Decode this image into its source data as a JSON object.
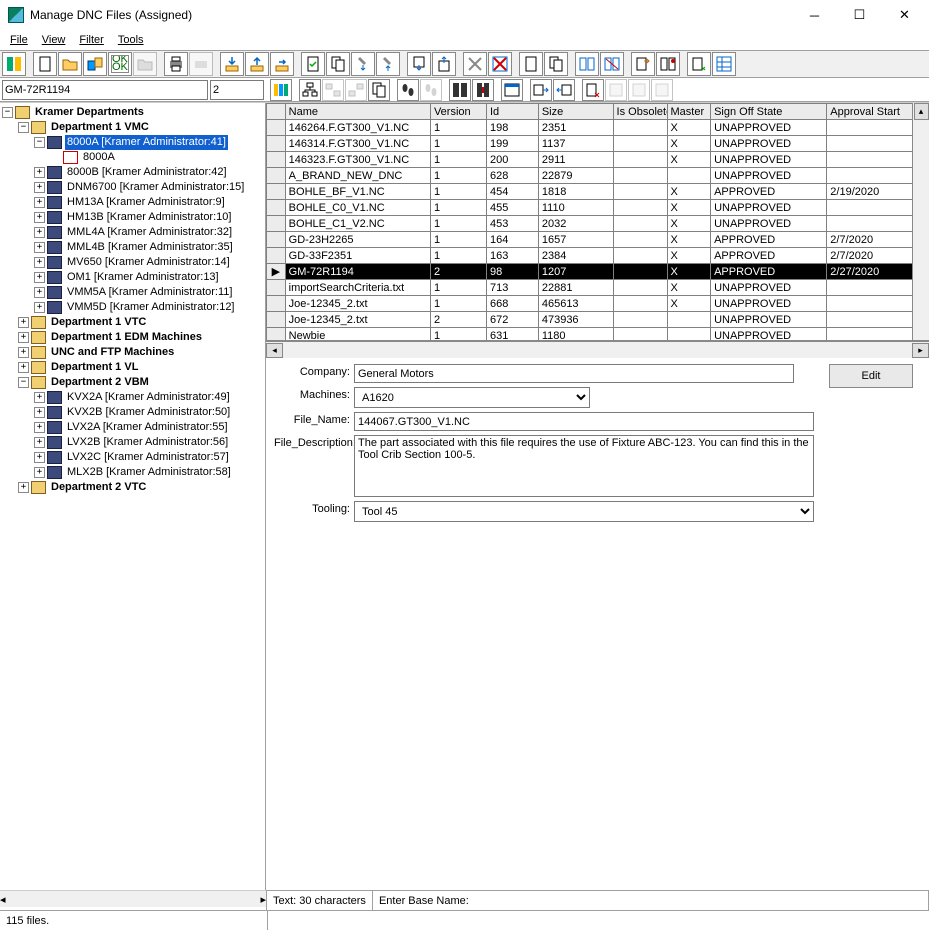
{
  "window": {
    "title": "Manage DNC Files (Assigned)"
  },
  "menu": {
    "file": "File",
    "view": "View",
    "filter": "Filter",
    "tools": "Tools"
  },
  "search": {
    "name": "GM-72R1194",
    "version": "2"
  },
  "tree": {
    "root": "Kramer Departments",
    "d1vmc": "Department 1 VMC",
    "n8000a_sel": "8000A [Kramer Administrator:41]",
    "n8000a_file": "8000A",
    "n8000b": "8000B [Kramer Administrator:42]",
    "dnm6700": "DNM6700 [Kramer Administrator:15]",
    "hm13a": "HM13A [Kramer Administrator:9]",
    "hm13b": "HM13B [Kramer Administrator:10]",
    "mml4a": "MML4A [Kramer Administrator:32]",
    "mml4b": "MML4B [Kramer Administrator:35]",
    "mv650": "MV650 [Kramer Administrator:14]",
    "om1": "OM1 [Kramer Administrator:13]",
    "vmm5a": "VMM5A [Kramer Administrator:11]",
    "vmm5d": "VMM5D [Kramer Administrator:12]",
    "d1vtc": "Department 1 VTC",
    "d1edm": "Department 1 EDM Machines",
    "unc": "UNC and FTP Machines",
    "d1vl": "Department 1 VL",
    "d2vbm": "Department 2 VBM",
    "kvx2a": "KVX2A [Kramer Administrator:49]",
    "kvx2b": "KVX2B [Kramer Administrator:50]",
    "lvx2a": "LVX2A [Kramer Administrator:55]",
    "lvx2b": "LVX2B [Kramer Administrator:56]",
    "lvx2c": "LVX2C [Kramer Administrator:57]",
    "mlx2b": "MLX2B [Kramer Administrator:58]",
    "d2vtc": "Department 2 VTC"
  },
  "grid": {
    "headers": {
      "name": "Name",
      "version": "Version",
      "id": "Id",
      "size": "Size",
      "obsolete": "Is Obsolete",
      "master": "Master",
      "signoff": "Sign Off State",
      "approval": "Approval Start"
    },
    "rows": [
      {
        "name": "146264.F.GT300_V1.NC",
        "version": "1",
        "id": "198",
        "size": "2351",
        "obsolete": "",
        "master": "X",
        "signoff": "UNAPPROVED",
        "approval": ""
      },
      {
        "name": "146314.F.GT300_V1.NC",
        "version": "1",
        "id": "199",
        "size": "1137",
        "obsolete": "",
        "master": "X",
        "signoff": "UNAPPROVED",
        "approval": ""
      },
      {
        "name": "146323.F.GT300_V1.NC",
        "version": "1",
        "id": "200",
        "size": "2911",
        "obsolete": "",
        "master": "X",
        "signoff": "UNAPPROVED",
        "approval": ""
      },
      {
        "name": "A_BRAND_NEW_DNC",
        "version": "1",
        "id": "628",
        "size": "22879",
        "obsolete": "",
        "master": "",
        "signoff": "UNAPPROVED",
        "approval": ""
      },
      {
        "name": "BOHLE_BF_V1.NC",
        "version": "1",
        "id": "454",
        "size": "1818",
        "obsolete": "",
        "master": "X",
        "signoff": "APPROVED",
        "approval": "2/19/2020"
      },
      {
        "name": "BOHLE_C0_V1.NC",
        "version": "1",
        "id": "455",
        "size": "1110",
        "obsolete": "",
        "master": "X",
        "signoff": "UNAPPROVED",
        "approval": ""
      },
      {
        "name": "BOHLE_C1_V2.NC",
        "version": "1",
        "id": "453",
        "size": "2032",
        "obsolete": "",
        "master": "X",
        "signoff": "UNAPPROVED",
        "approval": ""
      },
      {
        "name": "GD-23H2265",
        "version": "1",
        "id": "164",
        "size": "1657",
        "obsolete": "",
        "master": "X",
        "signoff": "APPROVED",
        "approval": "2/7/2020"
      },
      {
        "name": "GD-33F2351",
        "version": "1",
        "id": "163",
        "size": "2384",
        "obsolete": "",
        "master": "X",
        "signoff": "APPROVED",
        "approval": "2/7/2020"
      },
      {
        "name": "GM-72R1194",
        "version": "2",
        "id": "98",
        "size": "1207",
        "obsolete": "",
        "master": "X",
        "signoff": "APPROVED",
        "approval": "2/27/2020",
        "_sel": true
      },
      {
        "name": "importSearchCriteria.txt",
        "version": "1",
        "id": "713",
        "size": "22881",
        "obsolete": "",
        "master": "X",
        "signoff": "UNAPPROVED",
        "approval": ""
      },
      {
        "name": "Joe-12345_2.txt",
        "version": "1",
        "id": "668",
        "size": "465613",
        "obsolete": "",
        "master": "X",
        "signoff": "UNAPPROVED",
        "approval": ""
      },
      {
        "name": "Joe-12345_2.txt",
        "version": "2",
        "id": "672",
        "size": "473936",
        "obsolete": "",
        "master": "",
        "signoff": "UNAPPROVED",
        "approval": ""
      },
      {
        "name": "Newbie",
        "version": "1",
        "id": "631",
        "size": "1180",
        "obsolete": "",
        "master": "",
        "signoff": "UNAPPROVED",
        "approval": ""
      }
    ]
  },
  "form": {
    "company_label": "Company:",
    "company": "General Motors",
    "machines_label": "Machines:",
    "machines": "A1620",
    "filename_label": "File_Name:",
    "filename": "144067.GT300_V1.NC",
    "filedesc_label": "File_Description:",
    "filedesc": "The part associated with this file requires the use of Fixture ABC-123. You can find this in the Tool Crib Section 100-5.",
    "tooling_label": "Tooling:",
    "tooling": "Tool 45",
    "edit": "Edit"
  },
  "status": {
    "left": "115 files.",
    "mid": "Text: 30 characters",
    "right": "Enter Base Name:"
  }
}
